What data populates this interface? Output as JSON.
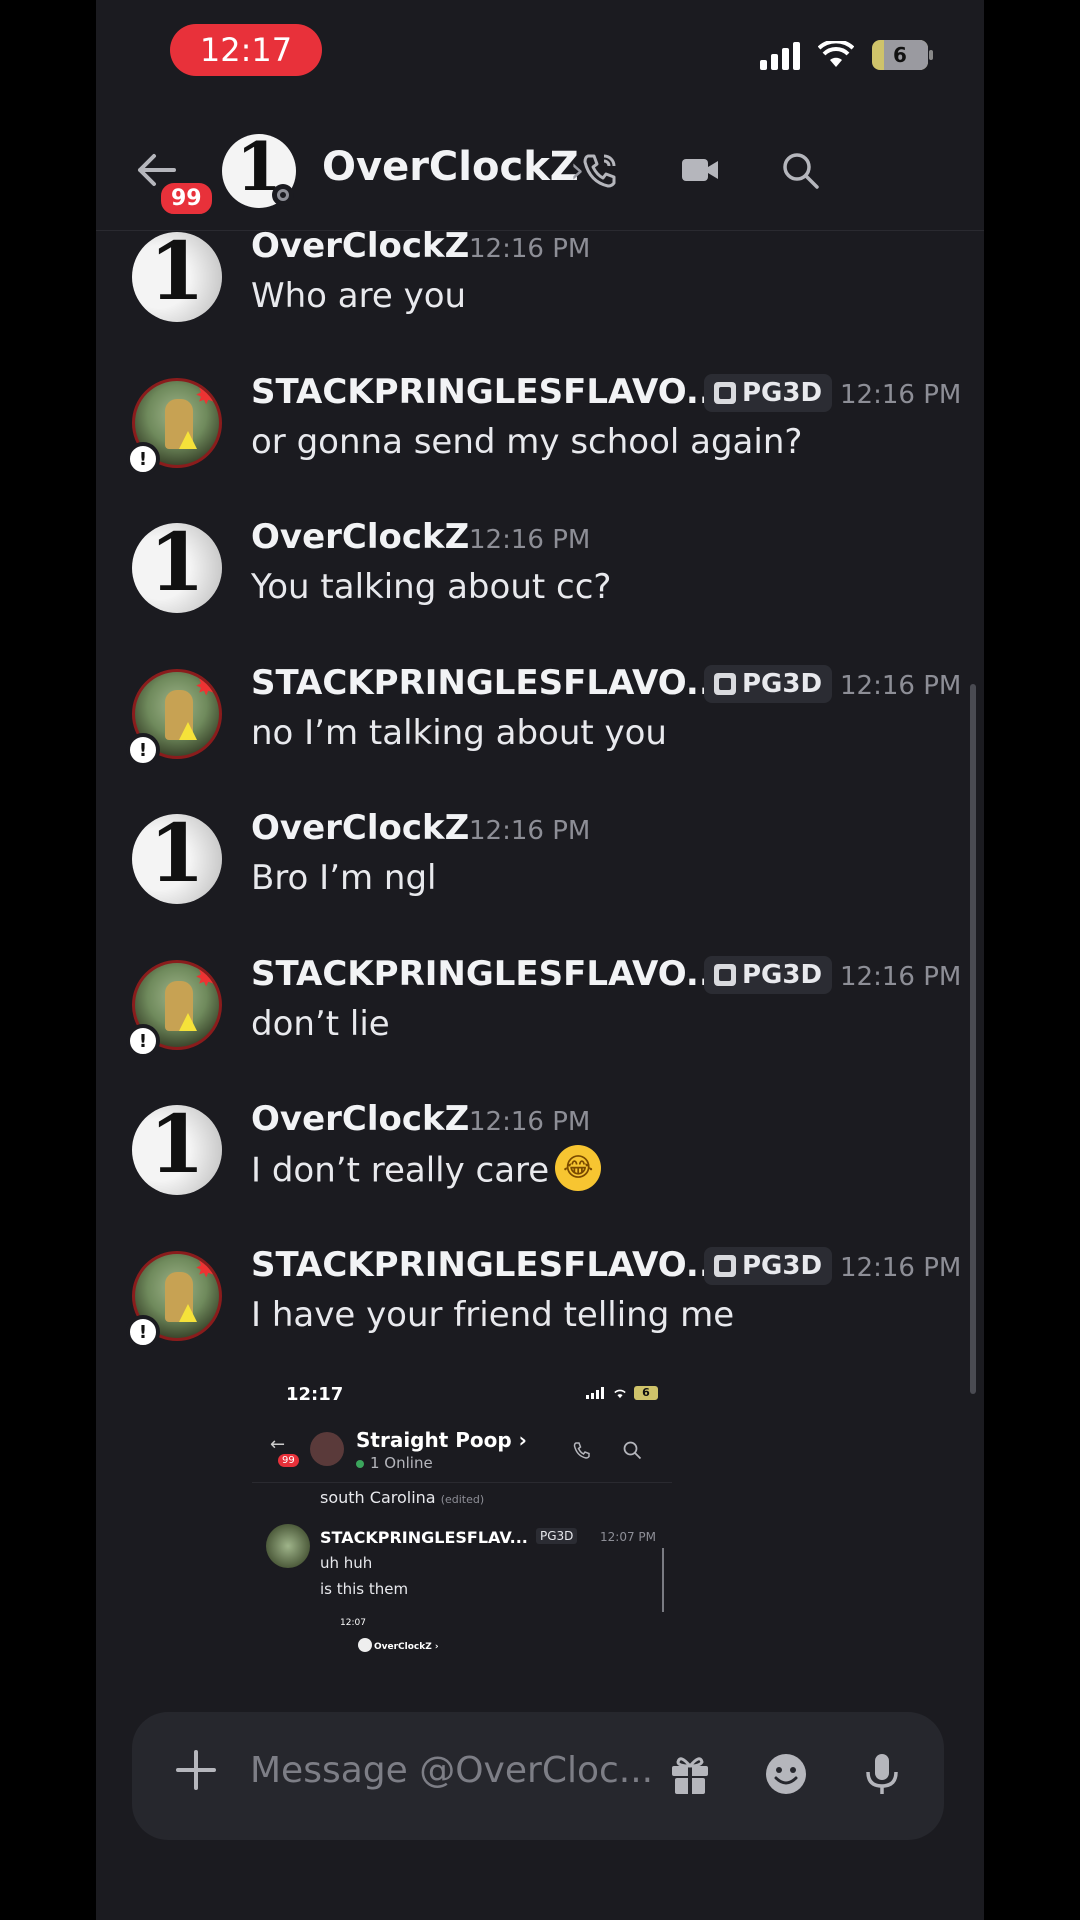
{
  "status_bar": {
    "time": "12:17",
    "battery": "6"
  },
  "header": {
    "title": "OverClockZ",
    "chevron": "›",
    "back_badge": "99"
  },
  "messages": [
    {
      "author": "OverClockZ",
      "time": "12:16 PM",
      "text": "Who are you",
      "avatar": "1"
    },
    {
      "author": "STACKPRINGLESFLAVO...",
      "tag": "PG3D",
      "time": "12:16 PM",
      "text": "or gonna send my school again?"
    },
    {
      "author": "OverClockZ",
      "time": "12:16 PM",
      "text": "You talking about cc?",
      "avatar": "1"
    },
    {
      "author": "STACKPRINGLESFLAVO...",
      "tag": "PG3D",
      "time": "12:16 PM",
      "text": "no I’m talking about you"
    },
    {
      "author": "OverClockZ",
      "time": "12:16 PM",
      "text": "Bro I’m ngl",
      "avatar": "1"
    },
    {
      "author": "STACKPRINGLESFLAVO...",
      "tag": "PG3D",
      "time": "12:16 PM",
      "text": "don’t lie"
    },
    {
      "author": "OverClockZ",
      "time": "12:16 PM",
      "text": "I don’t really care",
      "avatar": "1",
      "emoji": "😂"
    },
    {
      "author": "STACKPRINGLESFLAVO...",
      "tag": "PG3D",
      "time": "12:16 PM",
      "text": "I have your friend telling me"
    }
  ],
  "embed": {
    "time": "12:17",
    "battery": "6",
    "back_badge": "99",
    "title": "Straight Poop ›",
    "subtitle": "1 Online",
    "line1": "south Carolina",
    "edited": "(edited)",
    "author": "STACKPRINGLESFLAV...",
    "tag": "PG3D",
    "timestamp": "12:07 PM",
    "text1": "uh huh",
    "text2": "is this them",
    "mini_time": "12:07",
    "mini_title": "OverClockZ ›"
  },
  "composer": {
    "placeholder": "Message @OverCloc..."
  }
}
